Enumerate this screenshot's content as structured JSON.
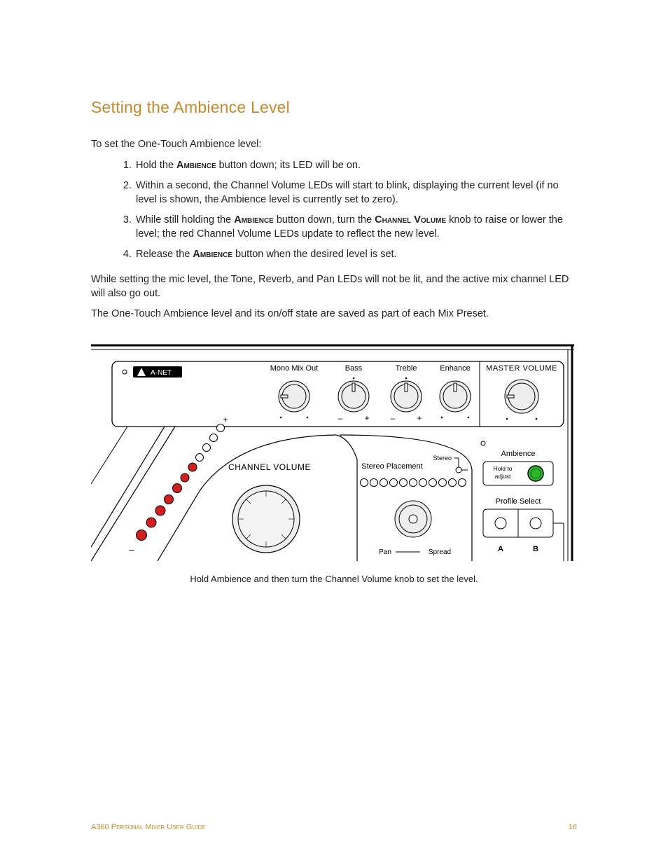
{
  "heading": "Setting the Ambience Level",
  "intro": "To set the One-Touch Ambience level:",
  "steps": {
    "s1_a": "Hold the ",
    "s1_sc": "Ambience",
    "s1_b": " button down; its LED will be on.",
    "s2": "Within a second, the Channel Volume LEDs will start to blink, displaying the current level (if no level is shown, the Ambience level is currently set to zero).",
    "s3_a": "While still holding the ",
    "s3_sc1": "Ambience",
    "s3_b": " button down, turn the ",
    "s3_sc2": "Channel Volume",
    "s3_c": " knob to raise or lower the level; the red Channel Volume LEDs update to reflect the new level.",
    "s4_a": "Release the ",
    "s4_sc": "Ambience",
    "s4_b": " button when the desired level is set."
  },
  "para2": "While setting the mic level, the Tone, Reverb, and Pan LEDs will not be lit, and the active mix channel LED will also go out.",
  "para3": "The One-Touch Ambience level and its on/off state are saved as part of each Mix Preset.",
  "caption": "Hold Ambience and then turn the Channel Volume knob to set the level.",
  "footer_left": "A360 Personal Mixer User Guide",
  "footer_right": "16",
  "diagram": {
    "anet": "A·NET",
    "mono": "Mono Mix Out",
    "bass": "Bass",
    "treble": "Treble",
    "enhance": "Enhance",
    "master": "MASTER VOLUME",
    "chvol": "CHANNEL VOLUME",
    "stereo_placement": "Stereo Placement",
    "stereo": "Stereo",
    "pan": "Pan",
    "spread": "Spread",
    "ambience": "Ambience",
    "hold": "Hold to",
    "adjust": "adjust",
    "profile": "Profile Select",
    "a": "A",
    "b": "B",
    "plus": "+",
    "minus": "–"
  }
}
